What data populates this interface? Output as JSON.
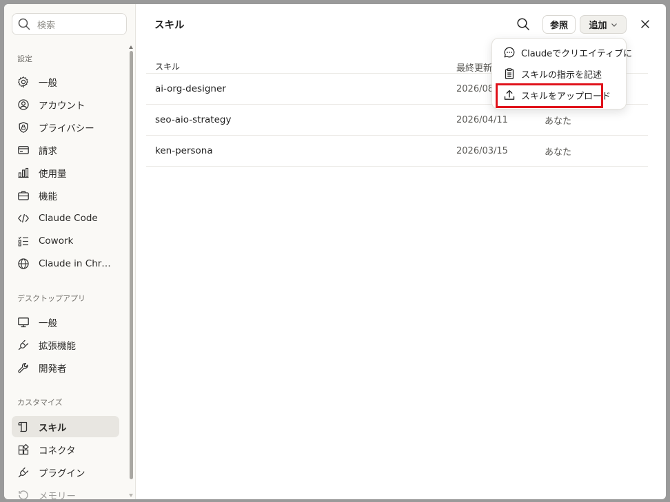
{
  "sidebar": {
    "search_placeholder": "検索",
    "sections": {
      "settings": "設定",
      "desktop": "デスクトップアプリ",
      "customize": "カスタマイズ"
    },
    "settings_items": [
      {
        "label": "一般",
        "icon": "gear-icon"
      },
      {
        "label": "アカウント",
        "icon": "user-circle-icon"
      },
      {
        "label": "プライバシー",
        "icon": "shield-lock-icon"
      },
      {
        "label": "請求",
        "icon": "credit-card-icon"
      },
      {
        "label": "使用量",
        "icon": "bar-chart-icon"
      },
      {
        "label": "機能",
        "icon": "briefcase-icon"
      },
      {
        "label": "Claude Code",
        "icon": "code-icon"
      },
      {
        "label": "Cowork",
        "icon": "checklist-icon"
      },
      {
        "label": "Claude in Chr…",
        "icon": "globe-icon"
      }
    ],
    "desktop_items": [
      {
        "label": "一般",
        "icon": "monitor-icon"
      },
      {
        "label": "拡張機能",
        "icon": "plug-icon"
      },
      {
        "label": "開発者",
        "icon": "wrench-icon"
      }
    ],
    "customize_items": [
      {
        "label": "スキル",
        "icon": "scroll-icon",
        "active": true
      },
      {
        "label": "コネクタ",
        "icon": "blocks-icon"
      },
      {
        "label": "プラグイン",
        "icon": "plug-icon"
      },
      {
        "label": "メモリー",
        "icon": "memory-icon"
      }
    ]
  },
  "header": {
    "title": "スキル",
    "browse_label": "参照",
    "add_label": "追加"
  },
  "table": {
    "columns": [
      "スキル",
      "最終更新"
    ],
    "rows": [
      {
        "name": "ai-org-designer",
        "date": "2026/08",
        "owner": ""
      },
      {
        "name": "seo-aio-strategy",
        "date": "2026/04/11",
        "owner": "あなた"
      },
      {
        "name": "ken-persona",
        "date": "2026/03/15",
        "owner": "あなた"
      }
    ]
  },
  "dropdown": {
    "items": [
      {
        "label": "Claudeでクリエイティブに",
        "icon": "chat-bubble-icon"
      },
      {
        "label": "スキルの指示を記述",
        "icon": "clipboard-icon"
      },
      {
        "label": "スキルをアップロード",
        "icon": "upload-icon"
      }
    ]
  },
  "colors": {
    "highlight": "#e0121b",
    "active_nav_bg": "#e8e6e1",
    "sidebar_bg": "#faf9f6"
  }
}
